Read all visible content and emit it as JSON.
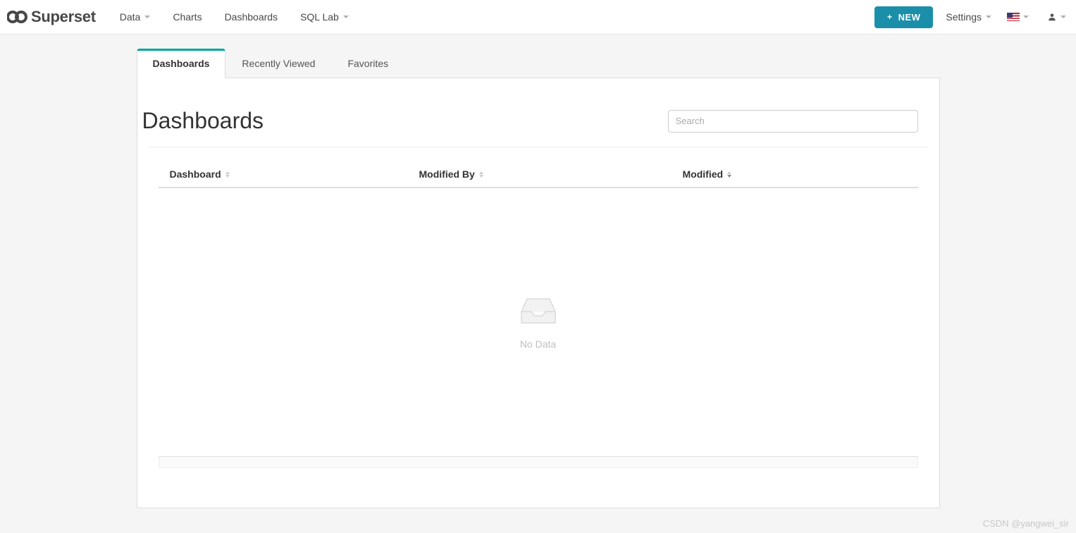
{
  "brand": {
    "name": "Superset"
  },
  "nav": {
    "data": "Data",
    "charts": "Charts",
    "dashboards": "Dashboards",
    "sqllab": "SQL Lab"
  },
  "actions": {
    "new": "NEW",
    "settings": "Settings"
  },
  "tabs": {
    "dashboards": "Dashboards",
    "recently": "Recently Viewed",
    "favorites": "Favorites"
  },
  "page": {
    "title": "Dashboards",
    "search_placeholder": "Search"
  },
  "table": {
    "col_dashboard": "Dashboard",
    "col_modified_by": "Modified By",
    "col_modified": "Modified",
    "empty": "No Data"
  },
  "watermark": "CSDN @yangwei_sir"
}
